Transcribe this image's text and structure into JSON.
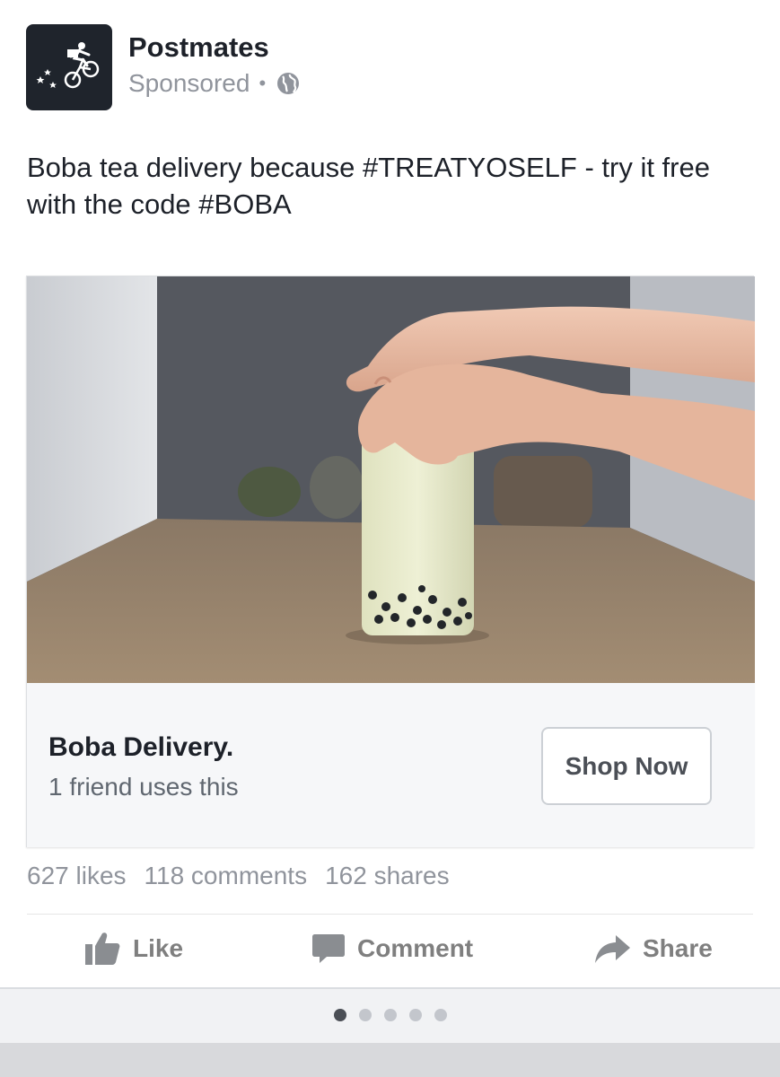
{
  "post": {
    "page_name": "Postmates",
    "sponsored_label": "Sponsored",
    "separator": "•",
    "body_text": "Boba tea delivery because #TREATYOSELF - try it free with the code #BOBA"
  },
  "card": {
    "title": "Boba Delivery.",
    "subtitle": "1 friend uses this",
    "cta_label": "Shop Now"
  },
  "stats": {
    "likes": "627 likes",
    "comments": "118 comments",
    "shares": "162 shares"
  },
  "actions": {
    "like_label": "Like",
    "comment_label": "Comment",
    "share_label": "Share"
  },
  "pager": {
    "total": 5,
    "active_index": 0
  },
  "icons": {
    "avatar_logo": "postmates-courier-bike-icon",
    "audience": "globe-icon",
    "like": "thumbs-up-icon",
    "comment": "speech-bubble-icon",
    "share": "share-arrow-icon"
  },
  "colors": {
    "text_primary": "#1d2129",
    "text_secondary": "#90949c",
    "action_text": "#7f7f7f",
    "avatar_bg": "#1f242c",
    "card_footer_bg": "#f6f7f9",
    "pager_active": "#4b4f56",
    "pager_inactive": "#c3c6cc"
  }
}
